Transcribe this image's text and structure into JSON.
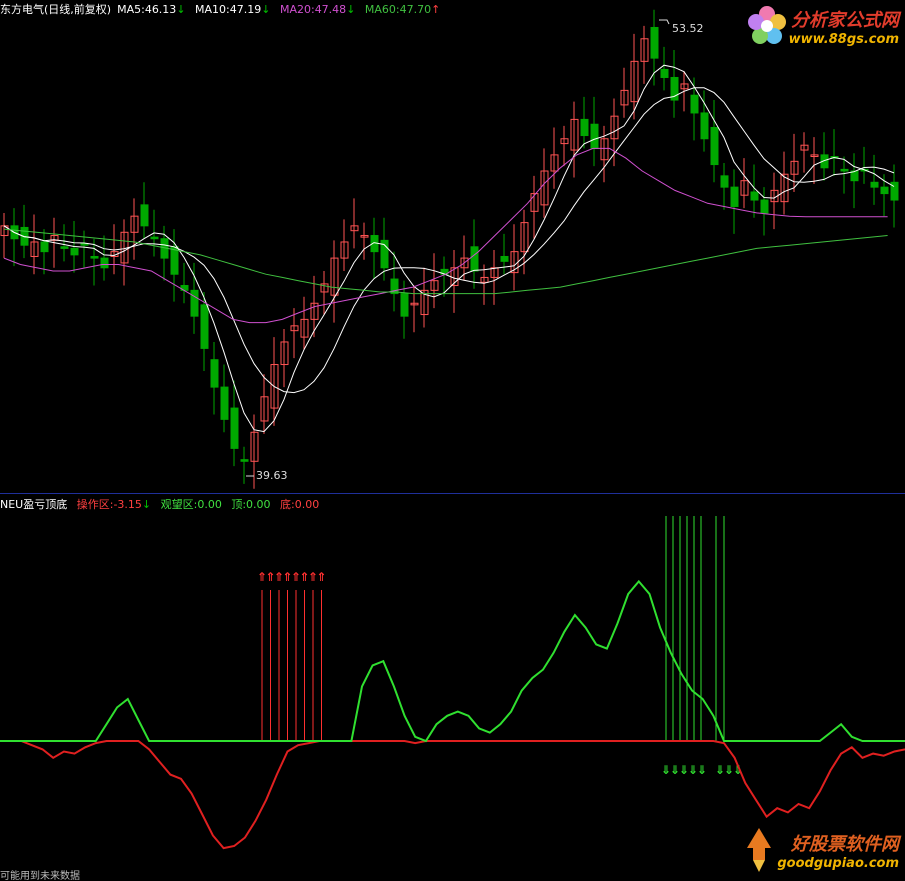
{
  "header": {
    "title": "东方电气(日线,前复权)",
    "ma5": "MA5:46.13",
    "ma10": "MA10:47.19",
    "ma20": "MA20:47.48",
    "ma60": "MA60:47.70",
    "arrow_down": "↓",
    "arrow_up": "↑"
  },
  "indicator_header": {
    "name": "NEU盈亏顶底",
    "op_zone": "操作区:-3.15",
    "watch_zone": "观望区:0.00",
    "top": "顶:0.00",
    "bottom": "底:0.00"
  },
  "price_labels": {
    "high": "53.52",
    "low": "39.63"
  },
  "logos": {
    "top_cn": "分析家公式网",
    "top_url": "www.88gs.com",
    "bottom_cn": "好股票软件网",
    "bottom_url": "goodgupiao.com"
  },
  "footer": "可能用到未来数据",
  "colors": {
    "up": "#ff5454",
    "down": "#00a800",
    "ma5": "#ffffff",
    "ma10": "#ffffff",
    "ma20": "#d050d0",
    "ma60": "#40c040",
    "watch": "#30e030",
    "op": "#e02020",
    "bottom_signal": "#ff3030",
    "top_signal": "#30e030"
  },
  "chart_data": [
    {
      "type": "candlestick",
      "title": "东方电气(日线,前复权)",
      "ylim": [
        39.63,
        53.52
      ],
      "series": [
        {
          "name": "MA5",
          "value": 46.13
        },
        {
          "name": "MA10",
          "value": 47.19
        },
        {
          "name": "MA20",
          "value": 47.48
        },
        {
          "name": "MA60",
          "value": 47.7
        }
      ],
      "annotations": [
        {
          "text": "53.52",
          "value": 53.52
        },
        {
          "text": "39.63",
          "value": 39.63
        }
      ],
      "ma60": [
        47.1,
        47.05,
        47.0,
        46.95,
        46.9,
        46.85,
        46.8,
        46.75,
        46.7,
        46.6,
        46.5,
        46.4,
        46.3,
        46.15,
        46.0,
        45.85,
        45.7,
        45.6,
        45.5,
        45.4,
        45.3,
        45.25,
        45.2,
        45.15,
        45.15,
        45.1,
        45.1,
        45.1,
        45.1,
        45.1,
        45.1,
        45.15,
        45.2,
        45.25,
        45.3,
        45.4,
        45.5,
        45.6,
        45.7,
        45.8,
        45.9,
        46.0,
        46.1,
        46.2,
        46.3,
        46.4,
        46.5,
        46.55,
        46.6,
        46.65,
        46.7,
        46.75,
        46.8,
        46.85,
        46.9
      ],
      "ma20": [
        46.2,
        46.0,
        45.9,
        45.8,
        45.8,
        45.9,
        46.0,
        46.0,
        45.9,
        45.8,
        45.5,
        45.2,
        44.9,
        44.6,
        44.3,
        44.2,
        44.2,
        44.3,
        44.5,
        44.7,
        44.8,
        44.9,
        45.0,
        45.1,
        45.2,
        45.3,
        45.5,
        45.7,
        46.0,
        46.4,
        46.9,
        47.4,
        47.9,
        48.5,
        49.0,
        49.4,
        49.6,
        49.6,
        49.3,
        48.9,
        48.6,
        48.3,
        48.1,
        47.9,
        47.8,
        47.7,
        47.6,
        47.55,
        47.5,
        47.48,
        47.48,
        47.48,
        47.48,
        47.48,
        47.48
      ]
    },
    {
      "type": "line",
      "title": "NEU盈亏顶底",
      "series": [
        {
          "name": "观望区",
          "value": 0.0
        },
        {
          "name": "操作区",
          "value": -3.15
        },
        {
          "name": "顶",
          "value": 0.0
        },
        {
          "name": "底",
          "value": 0.0
        }
      ],
      "watch": [
        0,
        0,
        0,
        0,
        0,
        0,
        0,
        0,
        0,
        0,
        0.8,
        1.6,
        2.0,
        1.0,
        0,
        0,
        0,
        0,
        0,
        0,
        0,
        0,
        0,
        0,
        0,
        0,
        0,
        0,
        0,
        0,
        0,
        0,
        0,
        0,
        2.6,
        3.6,
        3.8,
        2.6,
        1.2,
        0.2,
        0,
        0.8,
        1.2,
        1.4,
        1.2,
        0.6,
        0.4,
        0.8,
        1.4,
        2.4,
        3.0,
        3.4,
        4.2,
        5.2,
        6.0,
        5.4,
        4.6,
        4.4,
        5.6,
        7.0,
        7.6,
        7.0,
        5.4,
        4.2,
        3.2,
        2.4,
        2.0,
        1.2,
        0,
        0,
        0,
        0,
        0,
        0,
        0,
        0,
        0,
        0,
        0.4,
        0.8,
        0.2,
        0,
        0,
        0,
        0,
        0
      ],
      "op": [
        0,
        0,
        0,
        -0.2,
        -0.4,
        -0.8,
        -0.5,
        -0.6,
        -0.3,
        -0.1,
        0,
        0,
        0,
        0,
        -0.4,
        -1.0,
        -1.6,
        -1.8,
        -2.5,
        -3.5,
        -4.5,
        -5.1,
        -5.0,
        -4.6,
        -3.8,
        -2.8,
        -1.6,
        -0.5,
        -0.2,
        -0.1,
        0,
        0,
        0,
        0,
        0,
        0,
        0,
        0,
        0,
        -0.1,
        0,
        0,
        0,
        0,
        0,
        0,
        0,
        0,
        0,
        0,
        0,
        0,
        0,
        0,
        0,
        0,
        0,
        0,
        0,
        0,
        0,
        0,
        0,
        0,
        0,
        0,
        0,
        0,
        -0.1,
        -0.8,
        -2.0,
        -2.8,
        -3.6,
        -3.2,
        -3.4,
        -3.0,
        -3.2,
        -2.4,
        -1.4,
        -0.6,
        -0.3,
        -0.8,
        -0.6,
        -0.7,
        -0.5,
        -0.4
      ],
      "bottom_signals": 8,
      "top_signals": 8
    }
  ]
}
